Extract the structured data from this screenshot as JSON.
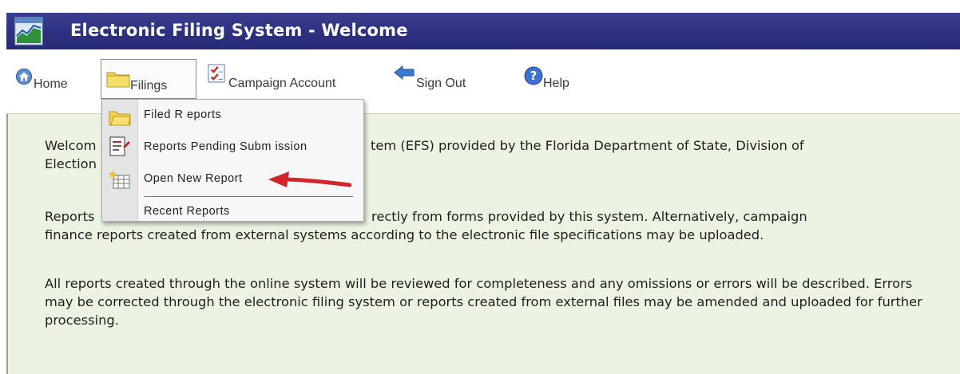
{
  "window": {
    "title": "Electronic Filing System - Welcome",
    "icon": "chart-icon"
  },
  "menu": {
    "home": "Home",
    "filings": "Filings",
    "campaign_account": "Campaign Account",
    "sign_out": "Sign Out",
    "help": "Help"
  },
  "dropdown": {
    "items": [
      {
        "label": "Filed R eports",
        "icon": "folder-icon"
      },
      {
        "label": "Reports Pending Subm ission",
        "icon": "pending-document-icon"
      },
      {
        "label": "Open New Report",
        "icon": "new-report-grid-icon"
      },
      {
        "label": "Recent Reports",
        "icon": ""
      }
    ]
  },
  "content": {
    "p1_line1": "Welcom",
    "p1_line1_tail": "tem (EFS) provided by the Florida Department of State, Division of",
    "p1_line2": "Election",
    "p2_line1": "Reports",
    "p2_line1_tail": "rectly from forms provided by this system. Alternatively, campaign",
    "p2_line2": "finance reports created from external systems according to the electronic file specifications may be uploaded.",
    "p3": "All reports created through the online system will be reviewed for completeness and any omissions or errors will be described. Errors may be corrected through the electronic filing system or reports created from external files may be amended and uploaded for further processing."
  },
  "colors": {
    "titlebar": "#2d3180",
    "content_bg": "#ecf3e3",
    "arrow": "#d1262c"
  }
}
